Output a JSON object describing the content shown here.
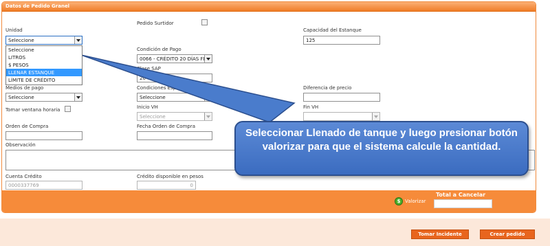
{
  "panel": {
    "title": "Datos de Pedido Granel"
  },
  "fields": {
    "pedido_surtidor": {
      "label": "Pedido Surtidor"
    },
    "unidad": {
      "label": "Unidad",
      "value": "Seleccione"
    },
    "capacidad_estanque": {
      "label": "Capacidad del Estanque",
      "value": "125"
    },
    "condicion_pago": {
      "label": "Condición de Pago",
      "value": "0066 - CRÉDITO 20 DÍAS FE"
    },
    "clase_sap": {
      "label": "Clase SAP",
      "value": "20"
    },
    "medios_pago": {
      "label": "Medios de pago",
      "value": "Seleccione"
    },
    "condiciones_especiales": {
      "label": "Condiciones Espe",
      "value": "Seleccione"
    },
    "diferencia_precio": {
      "label": "Diferencia de precio",
      "value": ""
    },
    "tomar_ventana": {
      "label": "Tomar ventana horaria"
    },
    "inicio_vh": {
      "label": "Inicio VH",
      "value": "Seleccione"
    },
    "fin_vh": {
      "label": "Fin VH",
      "value": ""
    },
    "orden_compra": {
      "label": "Orden de Compra",
      "value": ""
    },
    "fecha_orden": {
      "label": "Fecha Orden de Compra",
      "value": ""
    },
    "observacion": {
      "label": "Observación",
      "value": ""
    },
    "cuenta_credito": {
      "label": "Cuenta Crédito",
      "value": "0000337769"
    },
    "credito_disponible": {
      "label": "Crédito disponible en pesos",
      "value": "0"
    }
  },
  "unidad_options": [
    "Seleccione",
    "LITROS",
    "$ PESOS",
    "LLENAR ESTANQUE",
    "LÍMITE DE CRÉDITO"
  ],
  "unidad_selected_index": 3,
  "footer": {
    "valorizar_icon": "$",
    "valorizar_label": "Valorizar",
    "total_label": "Total a Cancelar",
    "total_value": ""
  },
  "buttons": {
    "tomar_incidente": "Tomar Incidente",
    "crear_pedido": "Crear pedido"
  },
  "callout": {
    "text": "Seleccionar Llenado de tanque y luego presionar botón valorizar para que el sistema calcule la cantidad."
  },
  "colors": {
    "accent_orange": "#f68b3a",
    "button_orange": "#e8651e",
    "callout_blue": "#4a7ccc",
    "selection_blue": "#3399ff"
  }
}
